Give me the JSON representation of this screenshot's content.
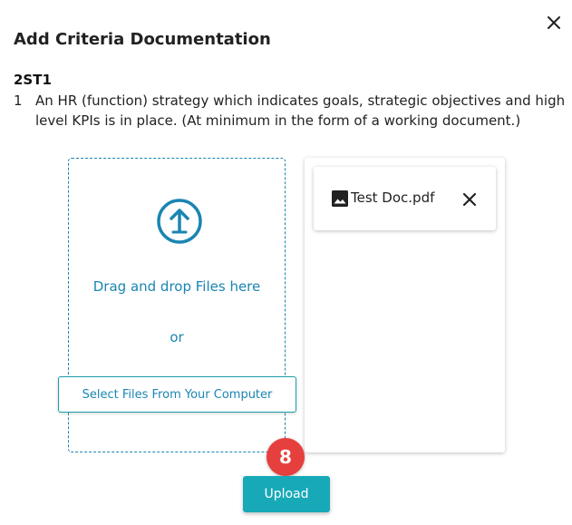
{
  "dialog": {
    "title": "Add Criteria Documentation",
    "close_icon": "close-icon"
  },
  "criteria": {
    "code": "2ST1",
    "number": "1",
    "text": "An HR (function) strategy which indicates goals, strategic objectives and high level KPIs is in place. (At minimum in the form of a working document.)"
  },
  "dropzone": {
    "icon": "upload-icon",
    "drag_text": "Drag and drop Files here",
    "or_text": "or",
    "select_label": "Select Files From Your Computer"
  },
  "files": [
    {
      "icon": "image-icon",
      "name": "Test Doc.pdf",
      "remove_icon": "close-icon"
    }
  ],
  "step_badge": "8",
  "upload_label": "Upload",
  "colors": {
    "accent": "#1a85b2",
    "button_teal": "#17a9b8",
    "badge_red": "#e5403d"
  }
}
